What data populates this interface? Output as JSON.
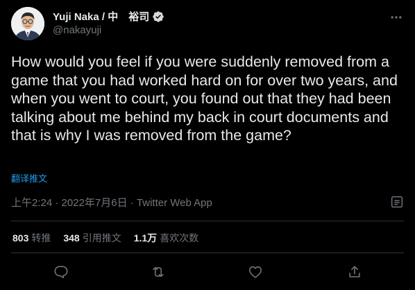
{
  "author": {
    "display_name": "Yuji Naka / 中　裕司",
    "handle": "@nakayuji",
    "verified": true,
    "avatar_icon": "avatar-photo"
  },
  "tweet": {
    "text": "How would you feel if you were suddenly removed from a game that you had worked hard on for over two years, and when you went to court, you found out that they had been talking about me behind my back in court documents and that is why I was removed from the game?",
    "translate_label": "翻译推文",
    "meta": "上午2:24 · 2022年7月6日 · Twitter Web App"
  },
  "stats": [
    {
      "count": "803",
      "label": "转推"
    },
    {
      "count": "348",
      "label": "引用推文"
    },
    {
      "count": "1.1万",
      "label": "喜欢次数"
    }
  ],
  "actions": [
    "reply-icon",
    "retweet-icon",
    "like-icon",
    "share-icon"
  ],
  "colors": {
    "background": "#000000",
    "text": "#e7e9ea",
    "secondary_text": "#71767b",
    "link": "#1d9bf0",
    "divider": "#2f3336"
  }
}
